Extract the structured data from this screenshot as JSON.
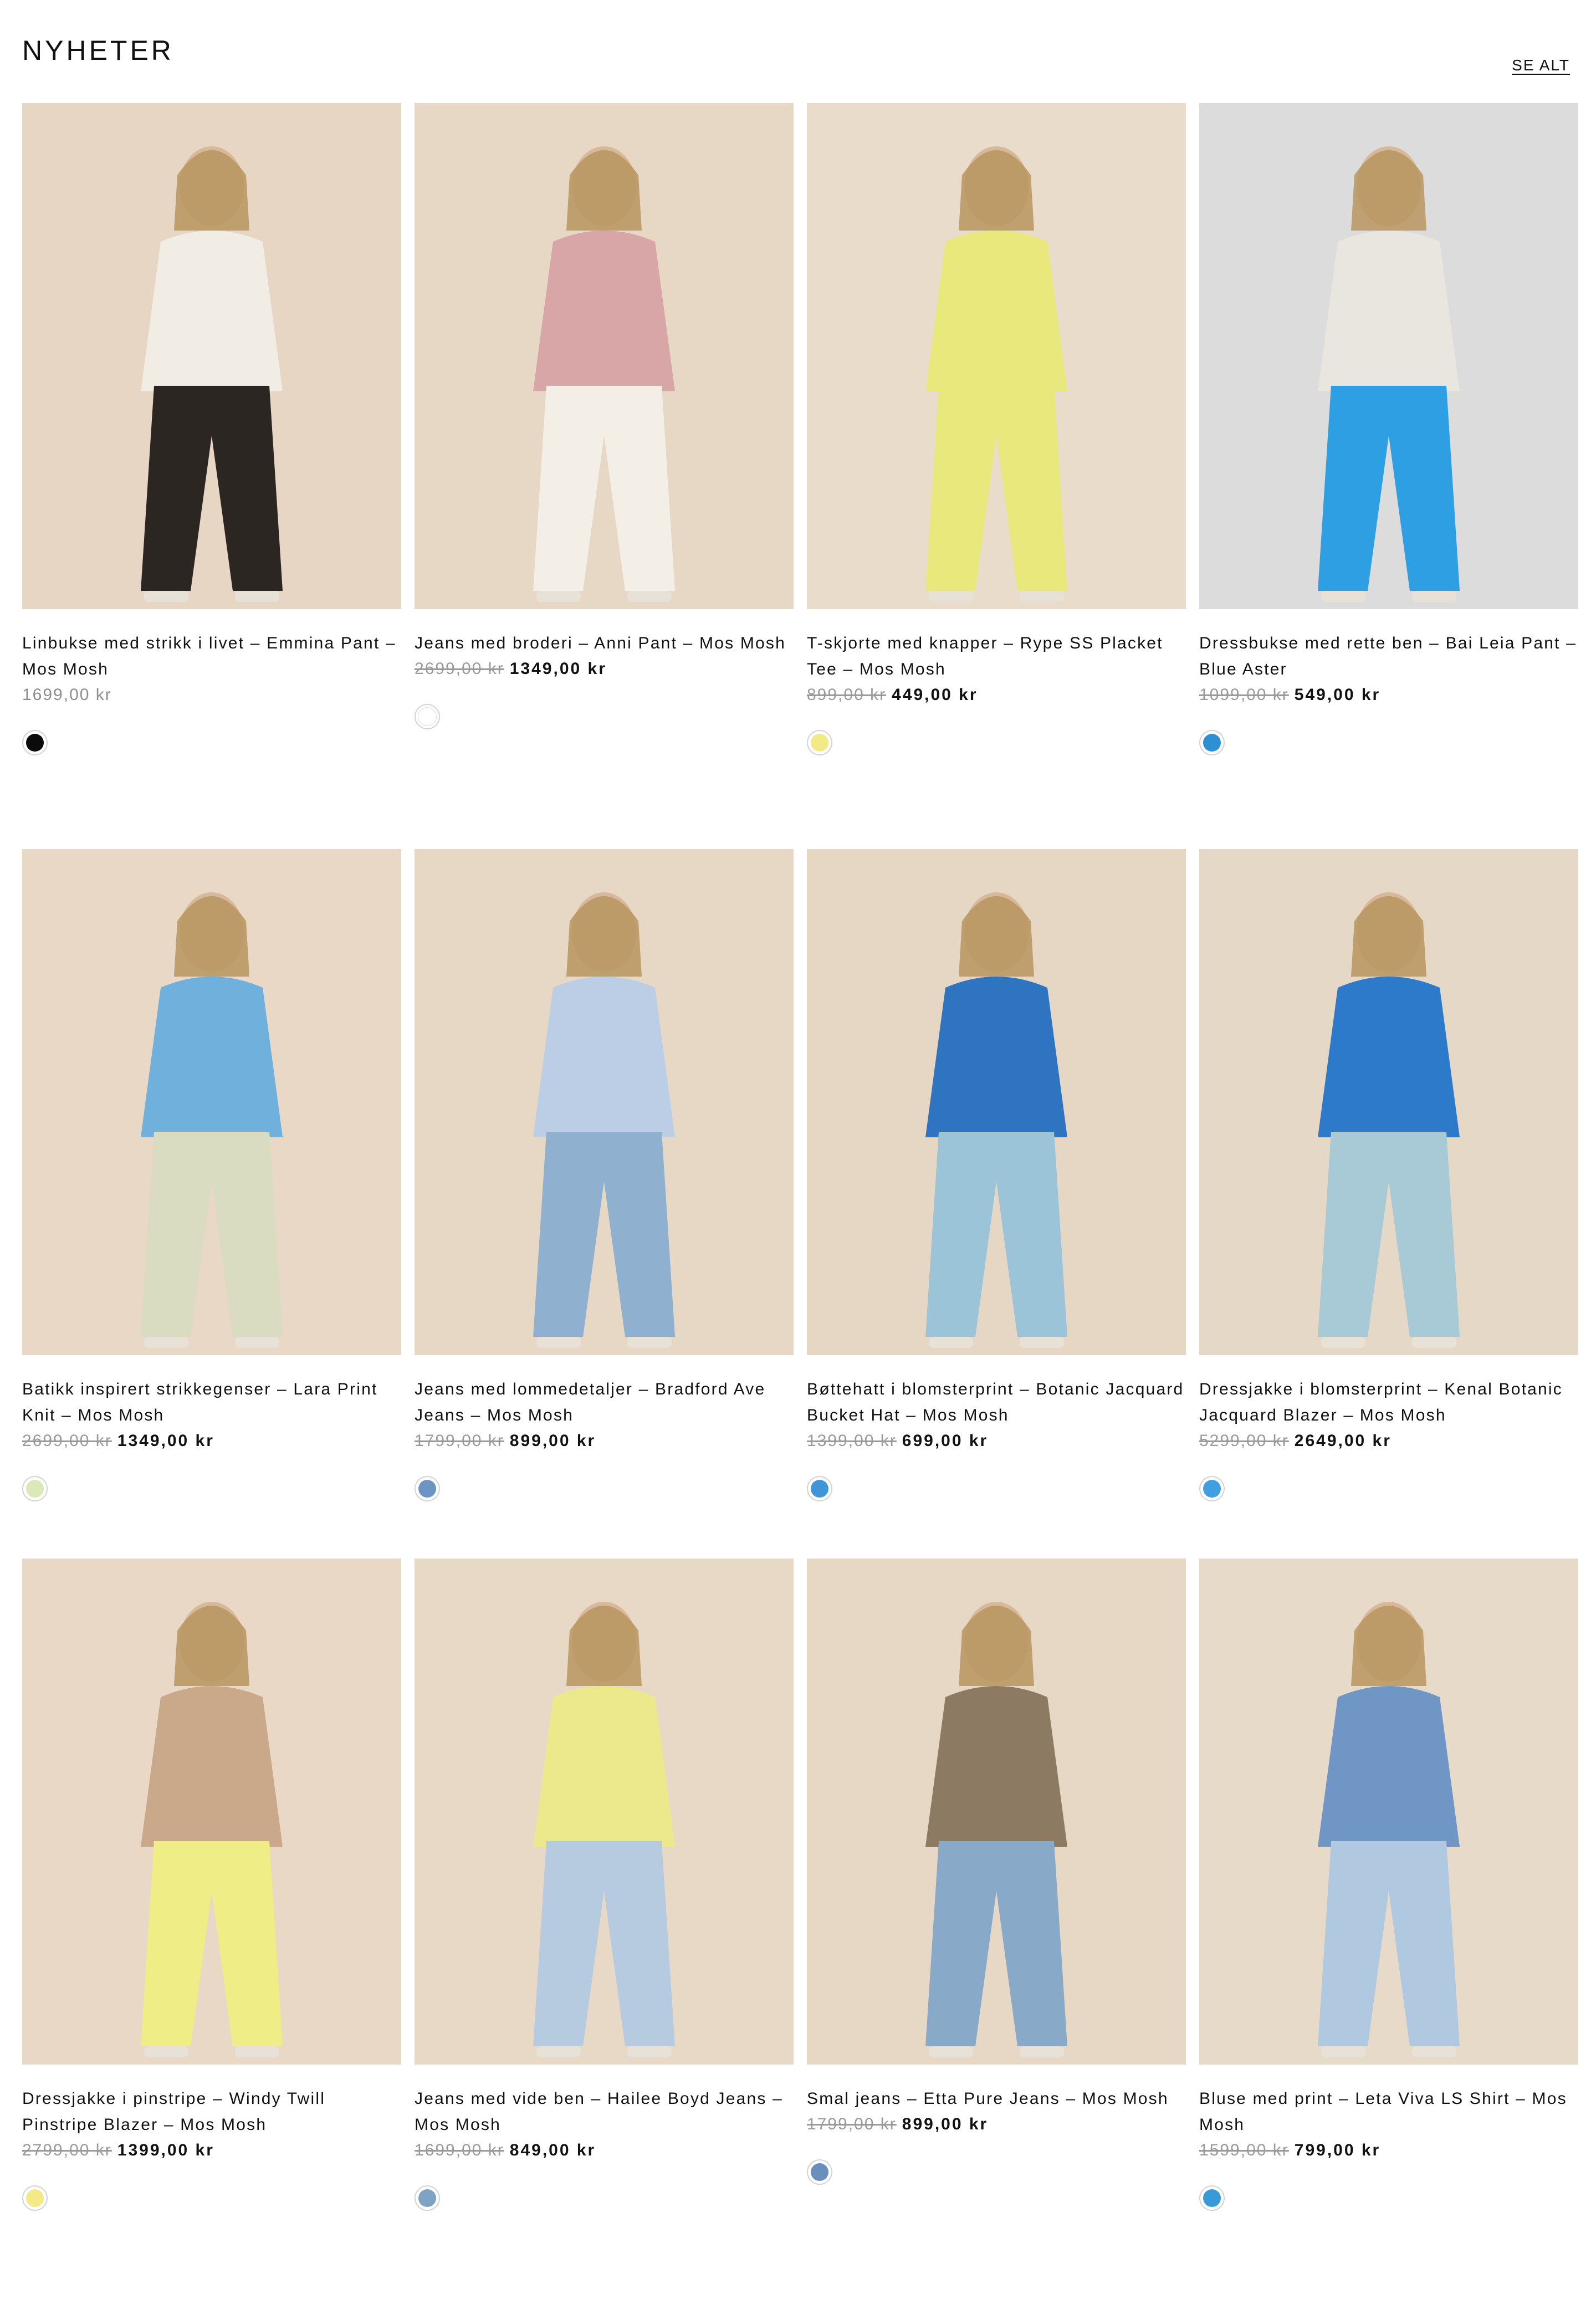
{
  "section": {
    "title": "NYHETER",
    "see_all": "SE ALT"
  },
  "products": [
    {
      "name": "Linbukse med strikk i livet – Emmina Pant – Mos Mosh",
      "old_price": "",
      "price": "1699,00 kr",
      "on_sale": false,
      "swatch": "#0b0b0b",
      "bg": "#e6d6c3",
      "garment": "#2c2622",
      "top": "#f1ece4"
    },
    {
      "name": "Jeans med broderi – Anni Pant – Mos Mosh",
      "old_price": "2699,00 kr",
      "price": "1349,00 kr",
      "on_sale": true,
      "swatch": "#ffffff",
      "bg": "#e7d8c6",
      "garment": "#f3eee6",
      "top": "#d9a6a8"
    },
    {
      "name": "T-skjorte med knapper – Rype SS Placket Tee – Mos Mosh",
      "old_price": "899,00 kr",
      "price": "449,00 kr",
      "on_sale": true,
      "swatch": "#f2ea86",
      "bg": "#e9dccb",
      "garment": "#e9e87c",
      "top": "#e9e87c"
    },
    {
      "name": "Dressbukse med rette ben – Bai Leia Pant – Blue Aster",
      "old_price": "1099,00 kr",
      "price": "549,00 kr",
      "on_sale": true,
      "swatch": "#2f8fd3",
      "bg": "#dcdcdc",
      "garment": "#2e9fe2",
      "top": "#e9e6df"
    },
    {
      "name": "Batikk inspirert strikkegenser – Lara Print Knit – Mos Mosh",
      "old_price": "2699,00 kr",
      "price": "1349,00 kr",
      "on_sale": true,
      "swatch": "#dbe8b7",
      "bg": "#e8d8c5",
      "garment": "#d9dcc0",
      "top": "#6fb0dc"
    },
    {
      "name": "Jeans med lommedetaljer – Bradford Ave Jeans – Mos Mosh",
      "old_price": "1799,00 kr",
      "price": "899,00 kr",
      "on_sale": true,
      "swatch": "#6c95c6",
      "bg": "#e7d8c6",
      "garment": "#8fb0cf",
      "top": "#bccde6"
    },
    {
      "name": "Bøttehatt i blomsterprint – Botanic Jacquard Bucket Hat – Mos Mosh",
      "old_price": "1399,00 kr",
      "price": "699,00 kr",
      "on_sale": true,
      "swatch": "#3f95d8",
      "bg": "#e6d7c5",
      "garment": "#9cc4d8",
      "top": "#2f74c0"
    },
    {
      "name": "Dressjakke i blomsterprint – Kenal Botanic Jacquard Blazer – Mos Mosh",
      "old_price": "5299,00 kr",
      "price": "2649,00 kr",
      "on_sale": true,
      "swatch": "#3f9fe0",
      "bg": "#e6d8c6",
      "garment": "#a8c9d6",
      "top": "#2c7ac9"
    },
    {
      "name": "Dressjakke i pinstripe – Windy Twill Pinstripe Blazer – Mos Mosh",
      "old_price": "2799,00 kr",
      "price": "1399,00 kr",
      "on_sale": true,
      "swatch": "#f3ea87",
      "bg": "#e8d8c5",
      "garment": "#eeed86",
      "top": "#c9a98a"
    },
    {
      "name": "Jeans med vide ben – Hailee Boyd Jeans – Mos Mosh",
      "old_price": "1699,00 kr",
      "price": "849,00 kr",
      "on_sale": true,
      "swatch": "#7fa3c2",
      "bg": "#e8d9c7",
      "garment": "#b7cbe0",
      "top": "#ebe98c"
    },
    {
      "name": "Smal jeans – Etta Pure Jeans – Mos Mosh",
      "old_price": "1799,00 kr",
      "price": "899,00 kr",
      "on_sale": true,
      "swatch": "#6a8fbd",
      "bg": "#e7d8c6",
      "garment": "#89a9c9",
      "top": "#8d7a62"
    },
    {
      "name": "Bluse med print – Leta Viva LS Shirt – Mos Mosh",
      "old_price": "1599,00 kr",
      "price": "799,00 kr",
      "on_sale": true,
      "swatch": "#3a9ad8",
      "bg": "#e8dac9",
      "garment": "#b0c9e0",
      "top": "#6f96c5"
    }
  ]
}
